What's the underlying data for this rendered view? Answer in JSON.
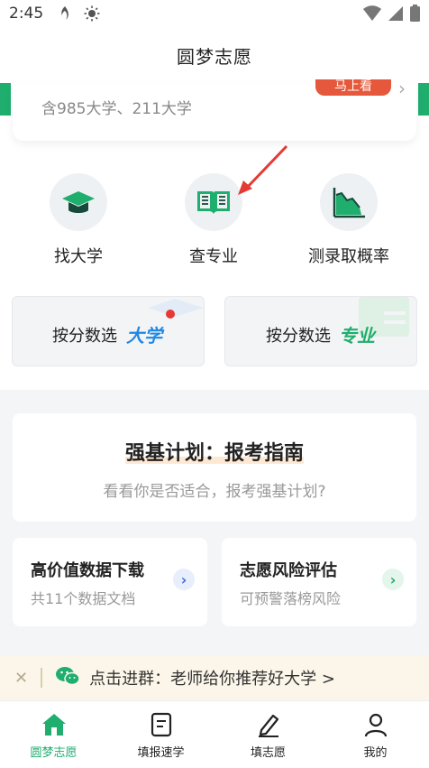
{
  "status_bar": {
    "time": "2:45"
  },
  "nav": {
    "title": "圆梦志愿"
  },
  "top_card": {
    "subtitle": "含985大学、211大学",
    "badge": "马上看"
  },
  "quick_actions": [
    {
      "label": "找大学",
      "icon": "graduation-cap-icon"
    },
    {
      "label": "查专业",
      "icon": "open-book-icon"
    },
    {
      "label": "测录取概率",
      "icon": "chart-area-icon"
    }
  ],
  "score_filters": [
    {
      "label": "按分数选",
      "accent": "大学",
      "accent_color": "#1e88e5"
    },
    {
      "label": "按分数选",
      "accent": "专业",
      "accent_color": "#1fae6d"
    }
  ],
  "qiangji": {
    "title": "强基计划：报考指南",
    "desc": "看看你是否适合，报考强基计划?"
  },
  "cards": [
    {
      "title": "高价值数据下载",
      "sub": "共11个数据文档",
      "arrow_color": "#3f6fd8",
      "arrow_bg": "#e8eefb"
    },
    {
      "title": "志愿风险评估",
      "sub": "可预警落榜风险",
      "arrow_color": "#1fae6d",
      "arrow_bg": "#e4f5ec"
    }
  ],
  "banner": {
    "text": "点击进群：老师给你推荐好大学 >"
  },
  "tabs": [
    {
      "label": "圆梦志愿",
      "icon": "home-icon",
      "active": true
    },
    {
      "label": "填报速学",
      "icon": "document-icon",
      "active": false
    },
    {
      "label": "填志愿",
      "icon": "pen-icon",
      "active": false
    },
    {
      "label": "我的",
      "icon": "user-icon",
      "active": false
    }
  ],
  "colors": {
    "brand_green": "#1fae6d",
    "badge_red": "#e5583b"
  }
}
